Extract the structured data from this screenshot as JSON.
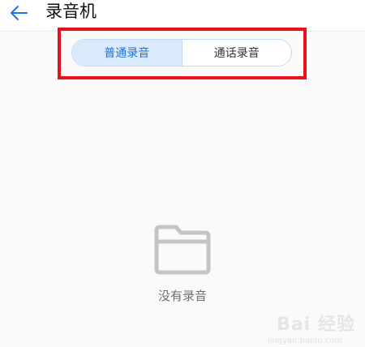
{
  "header": {
    "title": "录音机",
    "back_icon": "arrow-left-icon"
  },
  "tabs": [
    {
      "label": "普通录音",
      "selected": true
    },
    {
      "label": "通话录音",
      "selected": false
    }
  ],
  "empty_state": {
    "icon": "folder-icon",
    "text": "没有录音"
  },
  "watermark": {
    "logo": "Bai 经验",
    "url": "jingyan.baidu.com"
  },
  "colors": {
    "accent": "#1a73e8",
    "tab_selected_bg": "#dbeafb",
    "highlight": "#e8101a",
    "icon_gray": "#c4c4c4"
  }
}
